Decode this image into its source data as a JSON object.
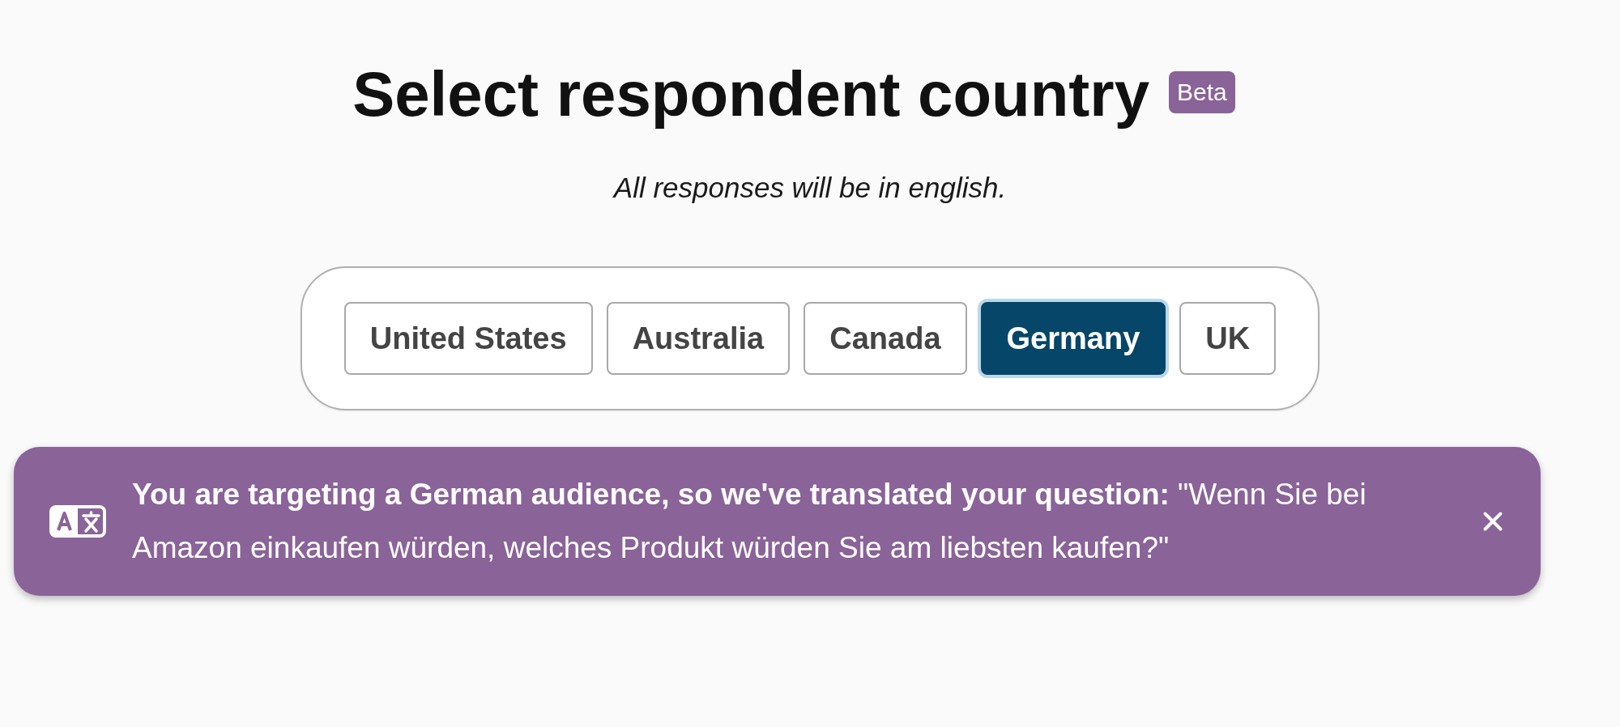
{
  "title": "Select respondent country",
  "badge": "Beta",
  "subtitle": "All responses will be in english.",
  "countries": [
    {
      "label": "United States",
      "selected": false
    },
    {
      "label": "Australia",
      "selected": false
    },
    {
      "label": "Canada",
      "selected": false
    },
    {
      "label": "Germany",
      "selected": true
    },
    {
      "label": "UK",
      "selected": false
    }
  ],
  "banner": {
    "message": "**You are targeting a German audience, so we've translated your question:** \"Wenn Sie bei Amazon einkaufen würden, welches Produkt würden Sie am liebsten kaufen?\""
  }
}
